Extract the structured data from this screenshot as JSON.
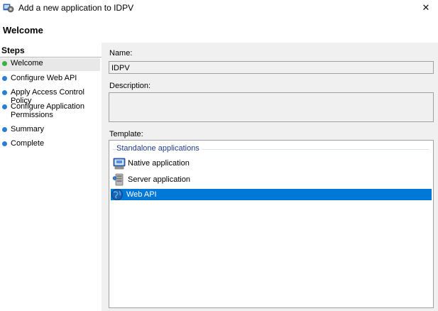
{
  "window": {
    "title": "Add a new application to IDPV",
    "close_glyph": "✕"
  },
  "header": {
    "title": "Welcome"
  },
  "steps": {
    "heading": "Steps",
    "items": [
      {
        "label": "Welcome",
        "status_color": "#3cb043",
        "active": true
      },
      {
        "label": "Configure Web API",
        "status_color": "#2a7fd4",
        "active": false
      },
      {
        "label": "Apply Access Control Policy",
        "status_color": "#2a7fd4",
        "active": false
      },
      {
        "label": "Configure Application Permissions",
        "status_color": "#2a7fd4",
        "active": false
      },
      {
        "label": "Summary",
        "status_color": "#2a7fd4",
        "active": false
      },
      {
        "label": "Complete",
        "status_color": "#2a7fd4",
        "active": false
      }
    ]
  },
  "form": {
    "name_label": "Name:",
    "name_value": "IDPV",
    "description_label": "Description:",
    "description_value": "",
    "template_label": "Template:"
  },
  "templates": {
    "group": "Standalone applications",
    "items": [
      {
        "label": "Native application",
        "icon": "native-application-icon",
        "selected": false
      },
      {
        "label": "Server application",
        "icon": "server-application-icon",
        "selected": false
      },
      {
        "label": "Web API",
        "icon": "web-api-icon",
        "selected": true
      }
    ]
  },
  "colors": {
    "selection": "#0078d7",
    "group_header": "#1e3c8c"
  }
}
